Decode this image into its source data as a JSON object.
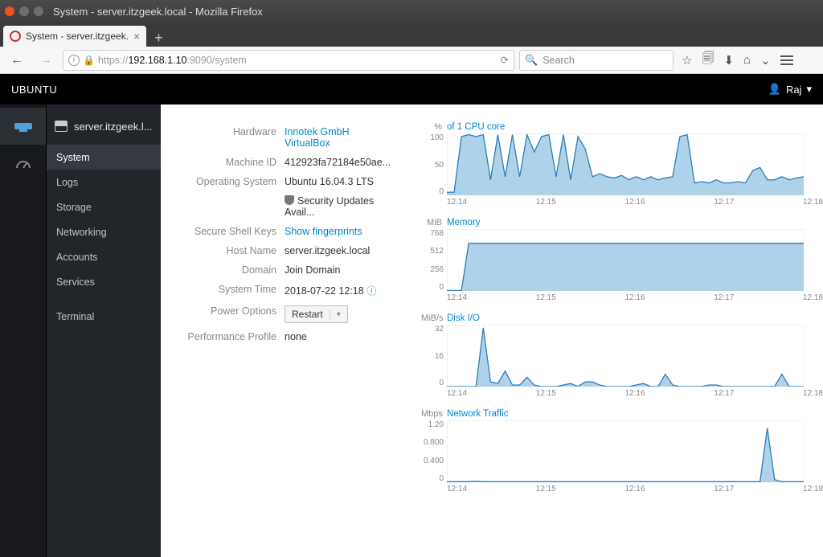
{
  "window": {
    "title": "System - server.itzgeek.local - Mozilla Firefox"
  },
  "browser": {
    "tab_title": "System - server.itzgeek.",
    "url_proto": "https://",
    "url_host": "192.168.1.10",
    "url_path": ":9090/system",
    "search_placeholder": "Search"
  },
  "cockpit": {
    "brand": "UBUNTU",
    "user": "Raj"
  },
  "host_label": "server.itzgeek.l...",
  "side": {
    "items": [
      {
        "label": "System",
        "active": true
      },
      {
        "label": "Logs"
      },
      {
        "label": "Storage"
      },
      {
        "label": "Networking"
      },
      {
        "label": "Accounts"
      },
      {
        "label": "Services"
      }
    ],
    "terminal": "Terminal"
  },
  "info": {
    "labels": {
      "hardware": "Hardware",
      "machine_id": "Machine ID",
      "os": "Operating System",
      "ssh": "Secure Shell Keys",
      "hostname": "Host Name",
      "domain": "Domain",
      "time": "System Time",
      "power": "Power Options",
      "perf": "Performance Profile"
    },
    "hardware_line1": "Innotek GmbH",
    "hardware_line2": "VirtualBox",
    "machine_id": "412923fa72184e50ae...",
    "os": "Ubuntu 16.04.3 LTS",
    "security_updates": "Security Updates Avail...",
    "ssh": "Show fingerprints",
    "hostname": "server.itzgeek.local",
    "domain": "Join Domain",
    "time": "2018-07-22 12:18",
    "power_btn": "Restart",
    "perf": "none"
  },
  "charts": {
    "x_ticks": [
      "12:14",
      "12:15",
      "12:16",
      "12:17",
      "12:18"
    ],
    "cpu": {
      "unit": "%",
      "title": "of 1 CPU core",
      "y": [
        "100",
        "50",
        "0"
      ]
    },
    "mem": {
      "unit": "MiB",
      "title": "Memory",
      "y": [
        "768",
        "512",
        "256",
        "0"
      ]
    },
    "disk": {
      "unit": "MiB/s",
      "title": "Disk I/O",
      "y": [
        "32",
        "16",
        "0"
      ]
    },
    "net": {
      "unit": "Mbps",
      "title": "Network Traffic",
      "y": [
        "1.20",
        "0.800",
        "0.400",
        "0"
      ]
    }
  },
  "chart_data": {
    "x_ticks": [
      "12:14",
      "12:15",
      "12:16",
      "12:17",
      "12:18"
    ],
    "cpu": {
      "type": "area",
      "unit": "%",
      "title": "of 1 CPU core",
      "ylim": [
        0,
        100
      ],
      "values": [
        5,
        5,
        95,
        98,
        95,
        98,
        25,
        98,
        30,
        98,
        30,
        98,
        70,
        95,
        98,
        30,
        98,
        25,
        95,
        75,
        30,
        35,
        30,
        28,
        32,
        25,
        30,
        25,
        30,
        25,
        28,
        30,
        95,
        98,
        20,
        22,
        20,
        25,
        20,
        20,
        22,
        20,
        40,
        45,
        25,
        25,
        30,
        25,
        28,
        30
      ]
    },
    "memory": {
      "type": "area",
      "unit": "MiB",
      "title": "Memory",
      "ylim": [
        0,
        1024
      ],
      "values": [
        5,
        5,
        5,
        790,
        790,
        790,
        790,
        790,
        790,
        790,
        790,
        790,
        790,
        790,
        790,
        790,
        790,
        790,
        790,
        790,
        790,
        790,
        790,
        790,
        790,
        790,
        790,
        790,
        790,
        790,
        790,
        790,
        790,
        790,
        790,
        790,
        790,
        790,
        790,
        790,
        790,
        790,
        790,
        790,
        790,
        790,
        790,
        790,
        790,
        790
      ]
    },
    "disk": {
      "type": "area",
      "unit": "MiB/s",
      "title": "Disk I/O",
      "ylim": [
        0,
        40
      ],
      "values": [
        0,
        0,
        0,
        0,
        0,
        38,
        3,
        2,
        10,
        1,
        1,
        6,
        1,
        0,
        0,
        0,
        1,
        2,
        0,
        3,
        3,
        1,
        0,
        0,
        0,
        0,
        1,
        2,
        0,
        0,
        8,
        1,
        0,
        0,
        0,
        0,
        1,
        1,
        0,
        0,
        0,
        0,
        0,
        0,
        0,
        0,
        8,
        0,
        0,
        0
      ]
    },
    "network": {
      "type": "area",
      "unit": "Mbps",
      "title": "Network Traffic",
      "ylim": [
        0,
        1.2
      ],
      "values": [
        0.01,
        0.01,
        0.01,
        0.01,
        0.02,
        0.01,
        0.01,
        0.01,
        0.01,
        0.01,
        0.01,
        0.01,
        0.01,
        0.01,
        0.01,
        0.01,
        0.01,
        0.01,
        0.01,
        0.01,
        0.01,
        0.01,
        0.01,
        0.01,
        0.01,
        0.01,
        0.01,
        0.01,
        0.01,
        0.01,
        0.01,
        0.01,
        0.01,
        0.01,
        0.01,
        0.01,
        0.01,
        0.01,
        0.01,
        0.01,
        0.01,
        0.01,
        0.01,
        0.01,
        1.05,
        0.05,
        0.01,
        0.01,
        0.01,
        0.01
      ]
    }
  }
}
